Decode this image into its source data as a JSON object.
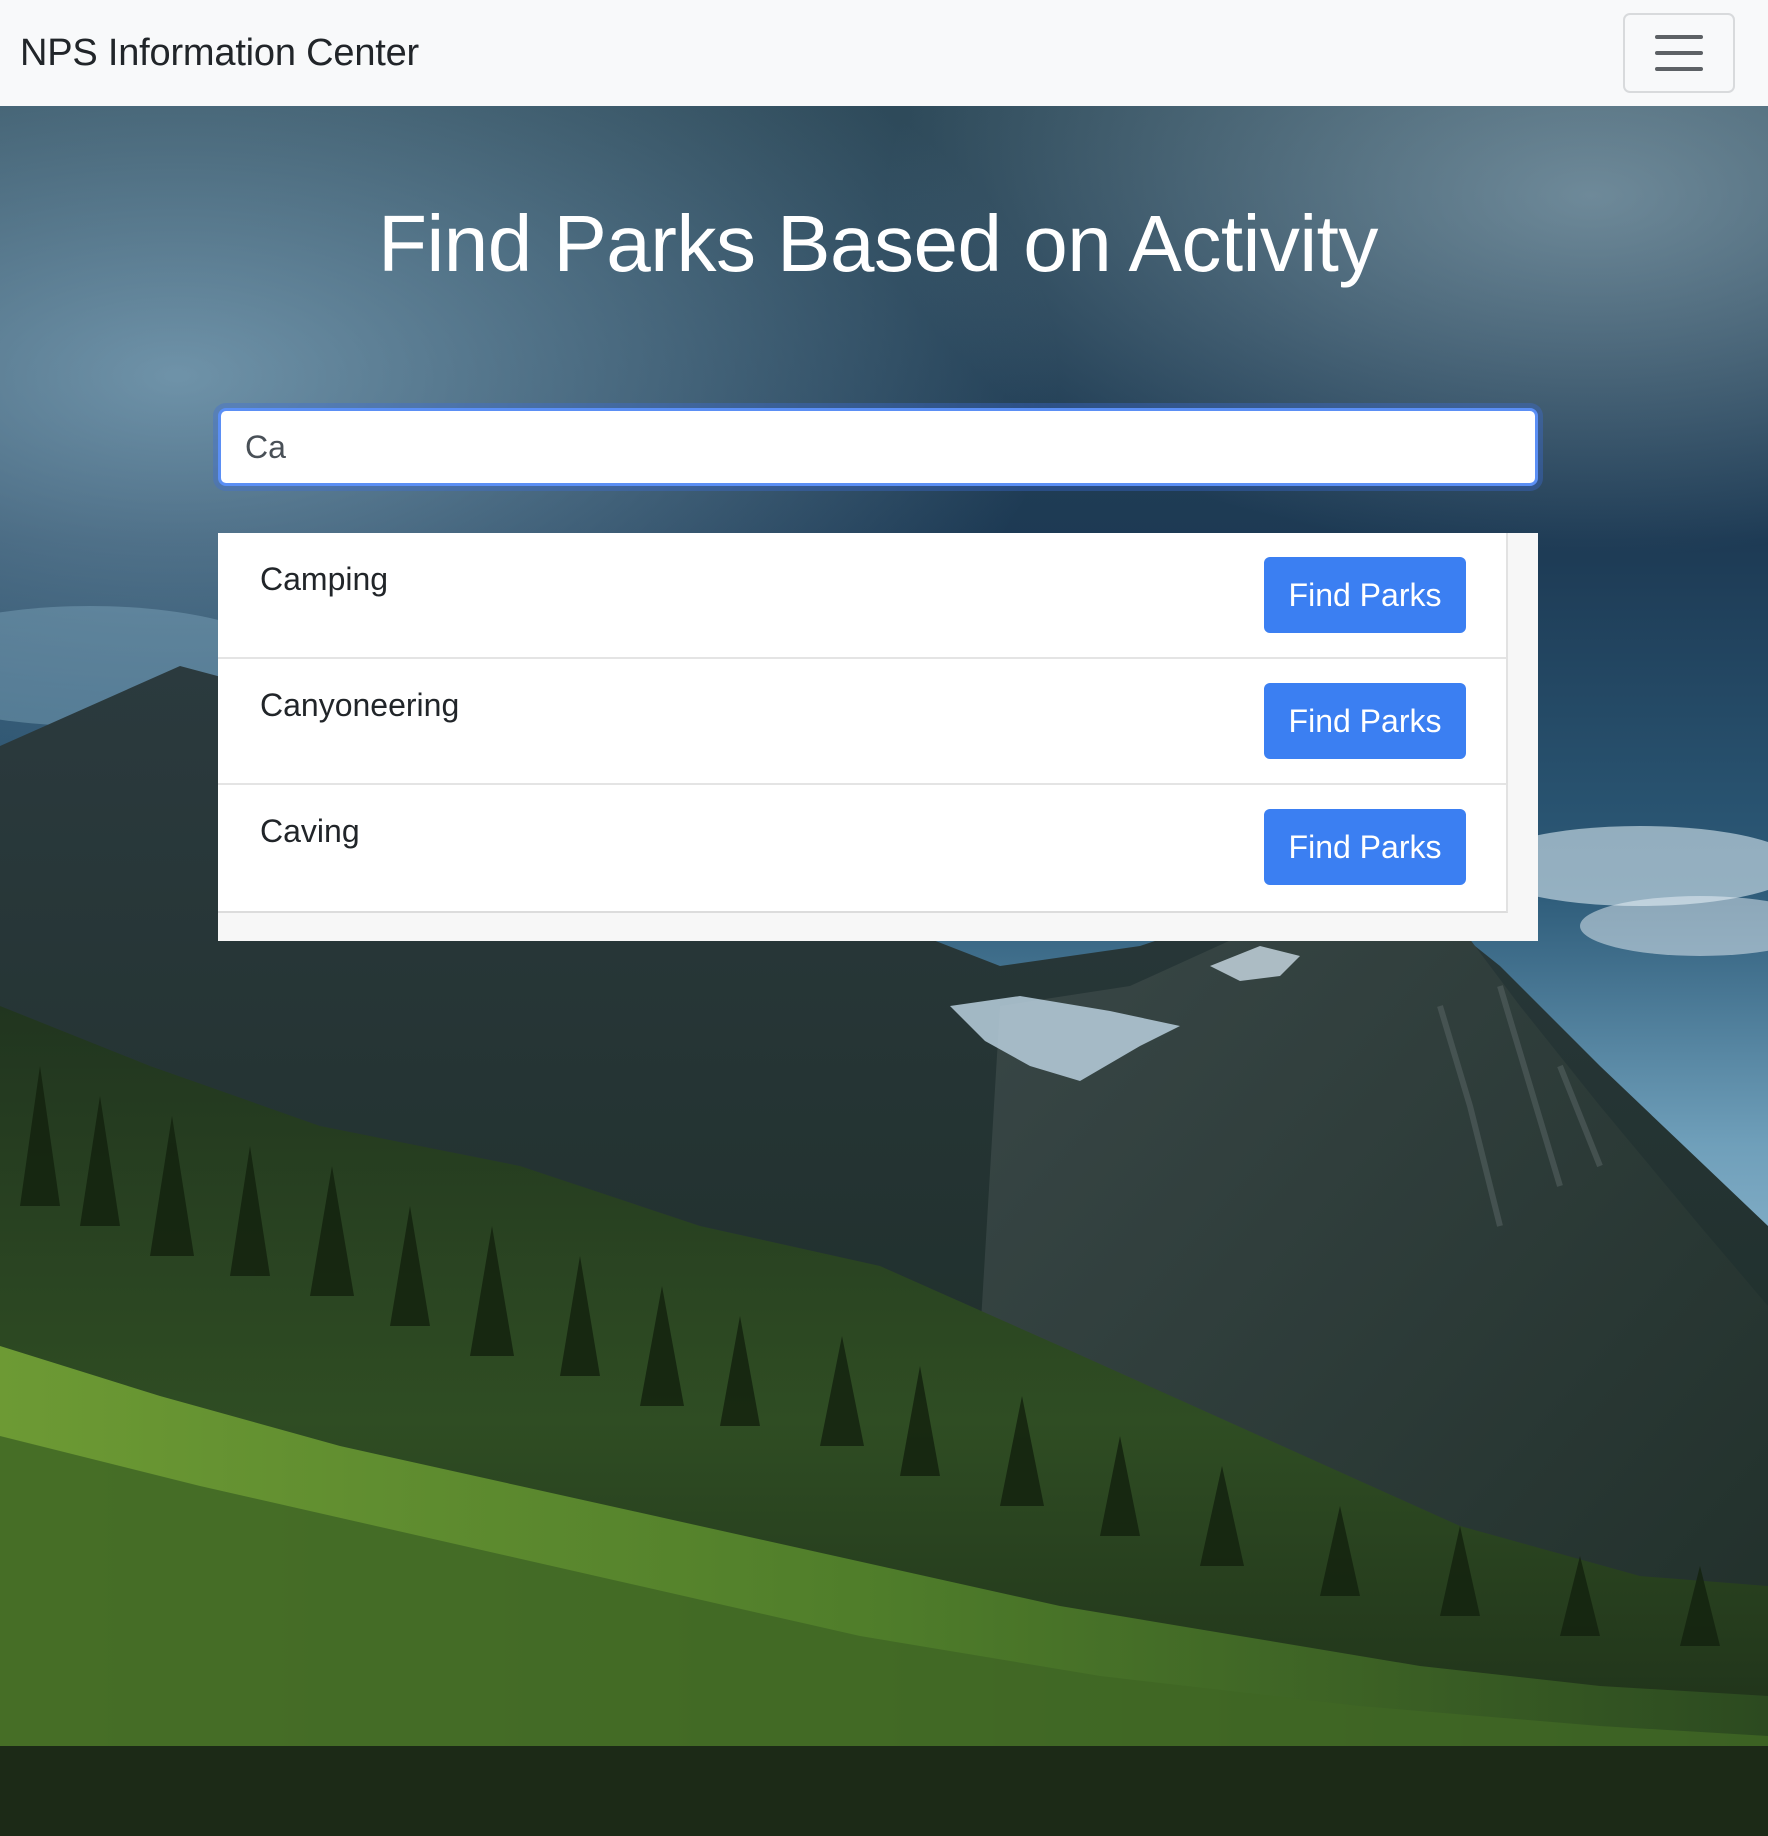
{
  "navbar": {
    "brand": "NPS Information Center",
    "menu_icon": "hamburger-menu-icon"
  },
  "hero": {
    "title": "Find Parks Based on Activity"
  },
  "search": {
    "value": "Ca"
  },
  "results": [
    {
      "name": "Camping",
      "button_label": "Find Parks"
    },
    {
      "name": "Canyoneering",
      "button_label": "Find Parks"
    },
    {
      "name": "Caving",
      "button_label": "Find Parks"
    }
  ],
  "colors": {
    "navbar_bg": "#f8f9fa",
    "button_primary": "#3b7ff2",
    "input_focus_border": "#5b8ff5",
    "title_text": "#ffffff"
  }
}
